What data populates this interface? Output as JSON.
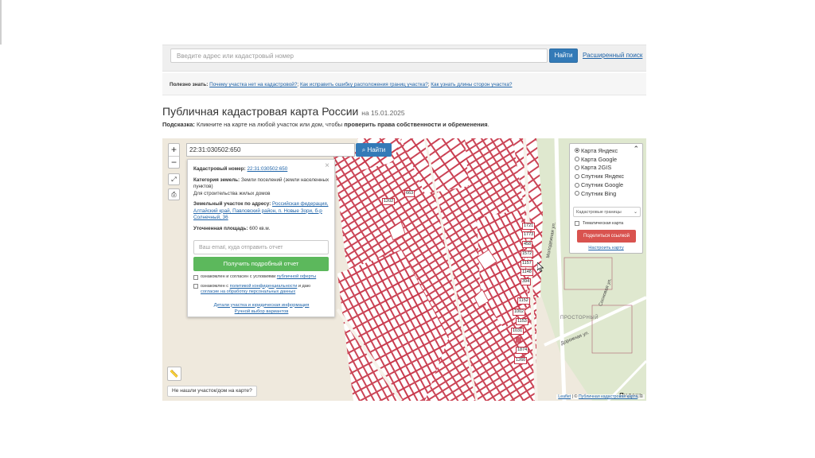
{
  "search": {
    "placeholder": "Введите адрес или кадастровый номер",
    "find_button": "Найти",
    "advanced_link": "Расширенный поиск"
  },
  "tips": {
    "lead": "Полезно знать:",
    "link1": "Почему участка нет на кадастровой?",
    "link2": "Как исправить ошибку расположения границ участка?",
    "link3": "Как узнать длины сторон участка?"
  },
  "header": {
    "title": "Публичная кадастровая карта России",
    "date": "на 15.01.2025"
  },
  "hint": {
    "icon": "",
    "label": "Подсказка:",
    "text": "Кликните на карте на любой участок или дом, чтобы",
    "bold": "проверить права собственности и обременения",
    "end": "."
  },
  "map": {
    "zoom_in": "+",
    "zoom_out": "−",
    "search_value": "22:31:030502:650",
    "search_button": "Найти",
    "not_found_button": "Не нашли участок/дом на карте?",
    "yandex_logo": "Яндекс",
    "attribution_leaflet": "Leaflet",
    "attribution_sep": " | © ",
    "attribution_cadastre": "Публичная кадастровая карта",
    "attribution_end": ", ©",
    "plot_labels": [
      "663",
      "1202",
      "1721",
      "1773",
      "458",
      "1572",
      "1157",
      "1148",
      "394",
      "1152",
      "1153",
      "1874",
      "1260",
      "1031",
      "1002"
    ],
    "street_labels": [
      "Молодежная ул.",
      "Сосновая ул.",
      "Дорожная ул.",
      "ПРОСТОРНЫЙ"
    ]
  },
  "popup": {
    "cadastral_label": "Кадастровый номер:",
    "cadastral_value": "22:31:030502:650",
    "category_label": "Категория земель:",
    "category_value": "Земли поселений (земли населенных пунктов)",
    "usage_value": "Для строительства жилых домов",
    "address_label": "Земельный участок по адресу:",
    "address_value": "Российская федерация, Алтайский край, Павловский район, п. Новые Зори, б-р Солнечный, 36",
    "area_label": "Уточненная площадь:",
    "area_value": "600 кв.м.",
    "email_placeholder": "Ваш email, куда отправить отчет",
    "report_button": "Получить подробный отчет",
    "consent1_text": "ознакомлен и согласен с условиями",
    "consent1_link": "публичной оферты",
    "consent2_text": "ознакомлен с",
    "consent2_link": "политикой конфиденциальности",
    "consent2_mid": "и даю",
    "consent2_link2": "согласие на обработку персональных данных",
    "details_link": "Детали участка и юридическая информация",
    "manual_link": "Ручной выбор вариантов"
  },
  "layers": {
    "options": [
      {
        "label": "Карта Яндекс",
        "selected": true
      },
      {
        "label": "Карта Google",
        "selected": false
      },
      {
        "label": "Карта 2GIS",
        "selected": false
      },
      {
        "label": "Спутник Яндекс",
        "selected": false
      },
      {
        "label": "Спутник Google",
        "selected": false
      },
      {
        "label": "Спутник Bing",
        "selected": false
      }
    ],
    "select_value": "Кадастровые границы",
    "thematic_label": "Тематическая карта",
    "share_button": "Поделиться ссылкой",
    "configure_link": "Настроить карту"
  },
  "colors": {
    "accent": "#337ab7",
    "success": "#5cb85c",
    "danger": "#d9534f",
    "parcel_border": "#c73246",
    "parcel_fill": "#ffffff"
  }
}
